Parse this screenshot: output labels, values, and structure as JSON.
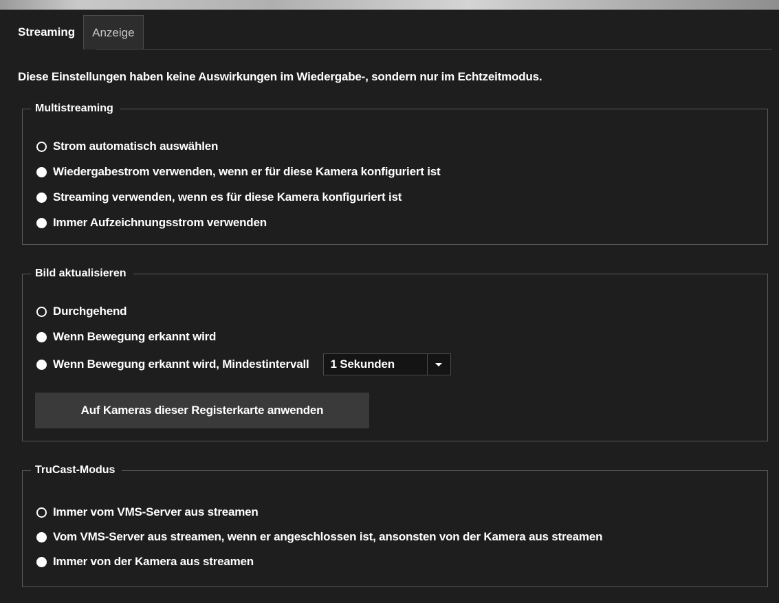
{
  "tabs": [
    {
      "label": "Streaming",
      "active": true
    },
    {
      "label": "Anzeige",
      "active": false
    }
  ],
  "intro_text": "Diese Einstellungen haben keine Auswirkungen im Wiedergabe-, sondern nur im Echtzeitmodus.",
  "multistreaming": {
    "title": "Multistreaming",
    "options": [
      "Strom automatisch auswählen",
      "Wiedergabestrom verwenden, wenn er für diese Kamera konfiguriert ist",
      "Streaming verwenden, wenn es für diese Kamera konfiguriert ist",
      "Immer Aufzeichnungsstrom verwenden"
    ],
    "selected_index": 0
  },
  "bild": {
    "title": "Bild aktualisieren",
    "options": [
      "Durchgehend",
      "Wenn Bewegung erkannt wird",
      "Wenn Bewegung erkannt wird, Mindestintervall"
    ],
    "selected_index": 0,
    "interval_value": "1 Sekunden",
    "apply_button": "Auf Kameras dieser Registerkarte anwenden"
  },
  "trucast": {
    "title": "TruCast-Modus",
    "options": [
      "Immer vom VMS-Server aus streamen",
      "Vom VMS-Server aus streamen, wenn er angeschlossen ist, ansonsten von der Kamera aus streamen",
      "Immer von der Kamera aus streamen"
    ],
    "selected_index": 0
  },
  "icons": {
    "dropdown": "chevron-down-icon"
  }
}
